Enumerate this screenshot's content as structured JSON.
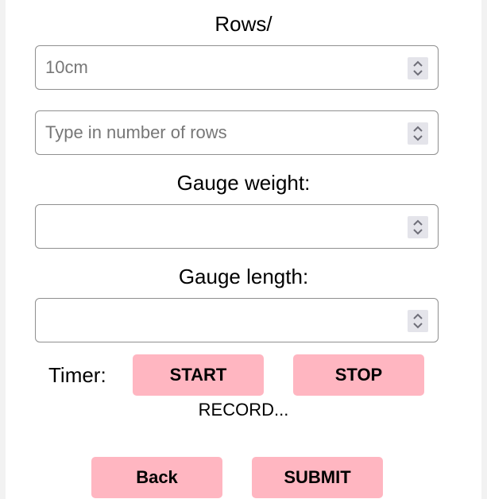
{
  "rows_label": "Rows/",
  "inputs": {
    "rows_per_10cm": {
      "value": "10cm"
    },
    "number_of_rows": {
      "placeholder": "Type in number of rows"
    },
    "gauge_weight": {
      "value": ""
    },
    "gauge_length": {
      "value": ""
    }
  },
  "gauge_weight_label": "Gauge weight:",
  "gauge_length_label": "Gauge length:",
  "timer": {
    "label": "Timer:",
    "start_label": "START",
    "stop_label": "STOP",
    "status": "RECORD..."
  },
  "actions": {
    "back_label": "Back",
    "submit_label": "SUBMIT"
  },
  "colors": {
    "button": "#ffb6c1",
    "border": "#8f8f8f",
    "placeholder": "#777777"
  },
  "icons": {
    "spinner": "up-down-chevron-icon"
  }
}
